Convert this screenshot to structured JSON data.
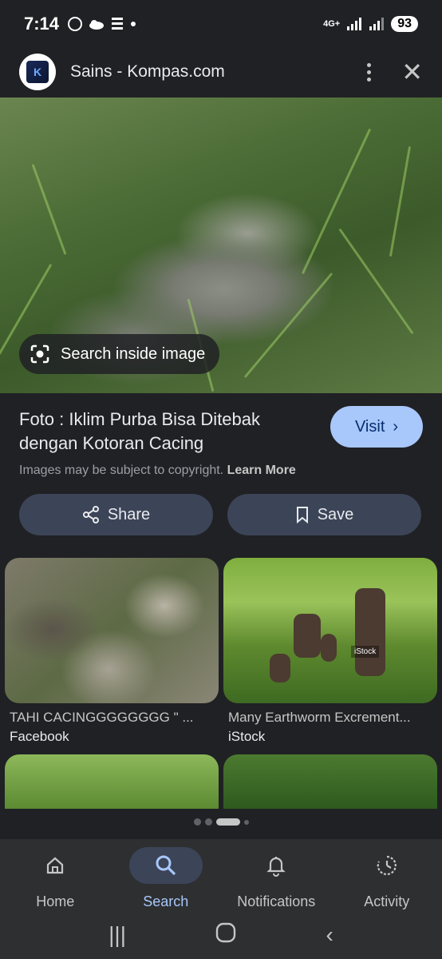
{
  "status_bar": {
    "time": "7:14",
    "network": "4G+",
    "battery": "93"
  },
  "header": {
    "site_title": "Sains - Kompas.com",
    "logo_letter": "K"
  },
  "hero": {
    "search_inside_label": "Search inside image"
  },
  "info": {
    "title": "Foto : Iklim Purba Bisa Ditebak dengan Kotoran Cacing",
    "visit_label": "Visit",
    "copyright_text": "Images may be subject to copyright.",
    "learn_more": "Learn More"
  },
  "actions": {
    "share_label": "Share",
    "save_label": "Save"
  },
  "results": [
    {
      "title": "TAHI CACINGGGGGGGG \" ...",
      "source": "Facebook"
    },
    {
      "title": "Many Earthworm Excrement...",
      "source": "iStock",
      "watermark": "iStock"
    }
  ],
  "bottom_nav": {
    "items": [
      {
        "label": "Home"
      },
      {
        "label": "Search"
      },
      {
        "label": "Notifications"
      },
      {
        "label": "Activity"
      }
    ]
  }
}
